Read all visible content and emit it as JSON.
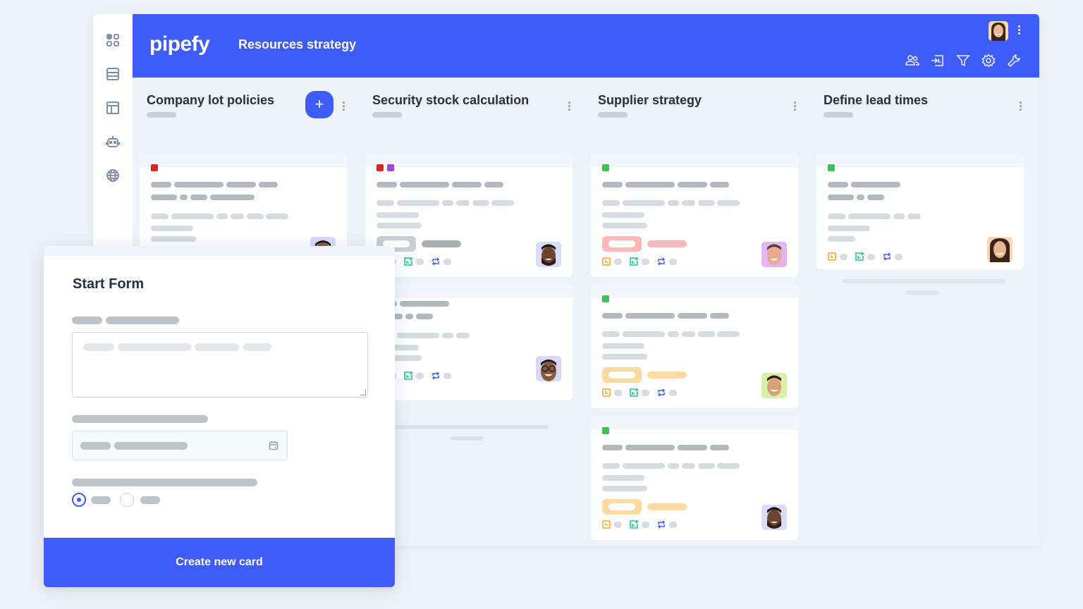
{
  "header": {
    "logo": "pipefy",
    "pipe_title": "Resources strategy"
  },
  "sidebar": {
    "items": [
      {
        "icon": "apps-grid-icon"
      },
      {
        "icon": "database-icon"
      },
      {
        "icon": "layout-icon"
      },
      {
        "icon": "robot-icon"
      },
      {
        "icon": "globe-icon"
      }
    ]
  },
  "toolbar": {
    "icons": [
      "members-icon",
      "import-icon",
      "filter-icon",
      "settings-icon",
      "wrench-icon"
    ]
  },
  "phases": [
    {
      "title": "Company lot policies",
      "has_add_button": true,
      "add_label": "+",
      "cards": [
        {
          "labels": [
            "#e02424"
          ],
          "tag_color": null
        }
      ]
    },
    {
      "title": "Security stock calculation",
      "has_add_button": false,
      "cards": [
        {
          "labels": [
            "#e02424",
            "#a046e0"
          ],
          "tag_color": "#c9cdd3"
        },
        {
          "labels": [],
          "tag_color": null
        }
      ]
    },
    {
      "title": "Supplier strategy",
      "has_add_button": false,
      "cards": [
        {
          "labels": [
            "#3fc056"
          ],
          "tag_color": "#ffb7b7"
        },
        {
          "labels": [
            "#3fc056"
          ],
          "tag_color": "#ffd9a0"
        },
        {
          "labels": [
            "#3fc056"
          ],
          "tag_color": "#ffd9a0"
        }
      ]
    },
    {
      "title": "Define lead times",
      "has_add_button": false,
      "cards": [
        {
          "labels": [
            "#3fc056"
          ],
          "tag_color": null
        }
      ]
    }
  ],
  "colors": {
    "brand": "#3e5cfb",
    "due_icon": "#f5a623",
    "created_icon": "#1ec77f",
    "repeat_icon": "#3e5cfb"
  },
  "start_form": {
    "title": "Start Form",
    "submit_label": "Create new card",
    "radio_selected_index": 0
  }
}
